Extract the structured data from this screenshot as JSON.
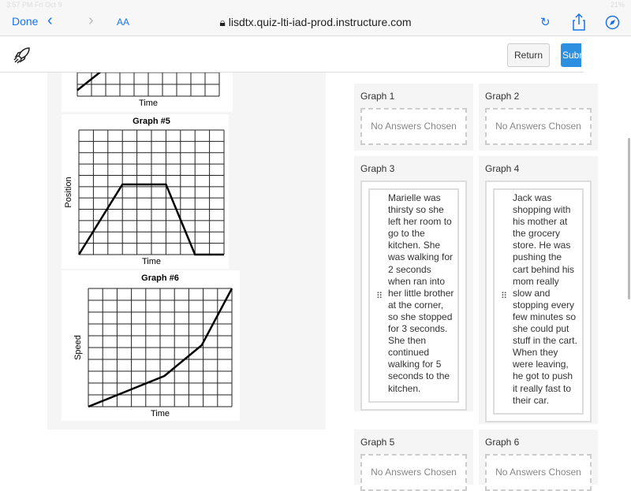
{
  "status": {
    "time": "3:57 PM  Fri Oct 9",
    "battery": "21%"
  },
  "browser": {
    "done": "Done",
    "back": "‹",
    "forward": "›",
    "text_size": "AA",
    "url": "lisdtx.quiz-lti-iad-prod.instructure.com",
    "icons": [
      "lock-icon",
      "reload-icon",
      "share-icon",
      "compass-icon"
    ]
  },
  "header": {
    "return_label": "Return",
    "submit_label": "Submit",
    "logo_icon": "rocket-icon"
  },
  "chart_data": [
    {
      "type": "line",
      "title": "",
      "xlabel": "Time",
      "ylabel": "",
      "grid": true,
      "partial": true,
      "cols": 5,
      "rows": 3,
      "x": [
        0,
        2,
        3
      ],
      "y": [
        0.5,
        2.4,
        2.5
      ]
    },
    {
      "type": "line",
      "title": "Graph #5",
      "xlabel": "Time",
      "ylabel": "Position",
      "grid": true,
      "cols": 10,
      "rows": 11,
      "x": [
        0,
        3,
        6,
        8,
        10
      ],
      "y": [
        0,
        6.2,
        6.2,
        0,
        0
      ]
    },
    {
      "type": "line",
      "title": "Graph #6",
      "xlabel": "Time",
      "ylabel": "Speed",
      "grid": true,
      "cols": 10,
      "rows": 10,
      "x": [
        0,
        5.3,
        7.9,
        10
      ],
      "y": [
        0,
        2.6,
        5.2,
        10
      ]
    }
  ],
  "answers": {
    "empty": "No Answers Chosen",
    "graphs": [
      {
        "label": "Graph 1"
      },
      {
        "label": "Graph 2"
      },
      {
        "label": "Graph 3",
        "text": "Marielle was thirsty so she left her room to go to the kitchen. She was walking for 2 seconds when ran into her little brother at the corner, so she stopped for 3 seconds. She then continued walking for 5 seconds to the kitchen."
      },
      {
        "label": "Graph 4",
        "text": "Jack was shopping with his mother at the grocery store. He was pushing the cart behind his mom really slow and stopping every few minutes so she could put stuff in the cart. When they were leaving, he got to push it really fast to their car."
      },
      {
        "label": "Graph 5"
      },
      {
        "label": "Graph 6"
      }
    ]
  }
}
